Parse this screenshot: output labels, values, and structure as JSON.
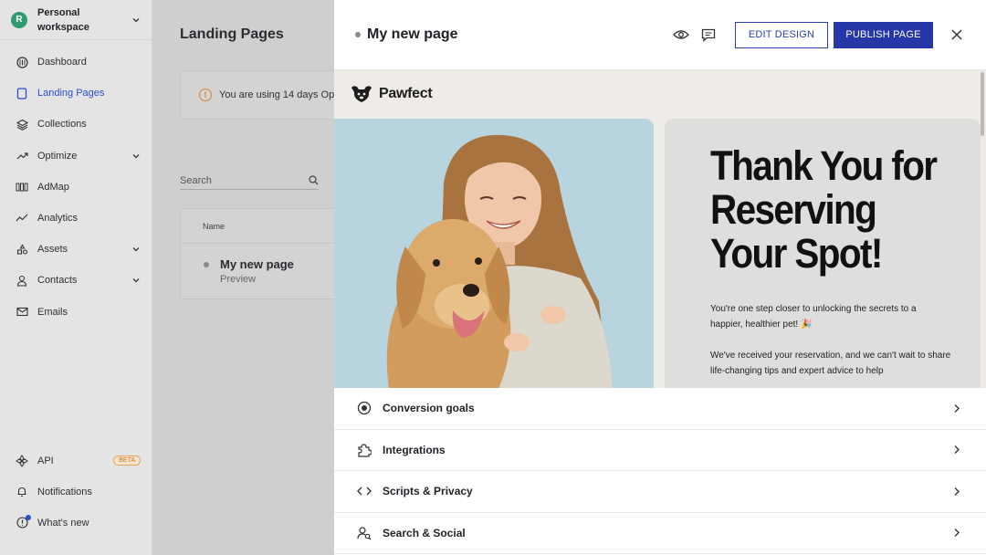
{
  "workspace": {
    "avatar_letter": "R",
    "name": "Personal workspace"
  },
  "sidebar": {
    "items": [
      {
        "label": "Dashboard",
        "icon": "dashboard-icon"
      },
      {
        "label": "Landing Pages",
        "icon": "page-icon"
      },
      {
        "label": "Collections",
        "icon": "layers-icon"
      },
      {
        "label": "Optimize",
        "icon": "trend-icon"
      },
      {
        "label": "AdMap",
        "icon": "admap-icon"
      },
      {
        "label": "Analytics",
        "icon": "analytics-icon"
      },
      {
        "label": "Assets",
        "icon": "assets-icon"
      },
      {
        "label": "Contacts",
        "icon": "contacts-icon"
      },
      {
        "label": "Emails",
        "icon": "mail-icon"
      }
    ],
    "bottom": [
      {
        "label": "API",
        "badge": "BETA"
      },
      {
        "label": "Notifications"
      },
      {
        "label": "What's new"
      }
    ]
  },
  "main": {
    "title": "Landing Pages",
    "notice": "You are using 14 days Opt",
    "search_placeholder": "Search",
    "table": {
      "column": "Name",
      "row_title": "My new page",
      "row_sub": "Preview"
    }
  },
  "drawer": {
    "page_title": "My new page",
    "edit_label": "EDIT DESIGN",
    "publish_label": "PUBLISH PAGE",
    "preview": {
      "brand": "Pawfect",
      "headline_1": "Thank You for",
      "headline_2": "Reserving",
      "headline_3": "Your Spot!",
      "para_1": "You're one step closer to unlocking the secrets to a happier, healthier pet! 🎉",
      "para_2": "We've received your reservation, and we can't wait to share life-changing tips and expert advice to help"
    },
    "settings": [
      {
        "label": "Conversion goals",
        "icon": "target-icon"
      },
      {
        "label": "Integrations",
        "icon": "puzzle-icon"
      },
      {
        "label": "Scripts & Privacy",
        "icon": "code-icon"
      },
      {
        "label": "Search & Social",
        "icon": "search-person-icon"
      }
    ]
  },
  "colors": {
    "accent": "#2638a7",
    "active_nav": "#2b4fd0",
    "warning": "#d9812d"
  }
}
